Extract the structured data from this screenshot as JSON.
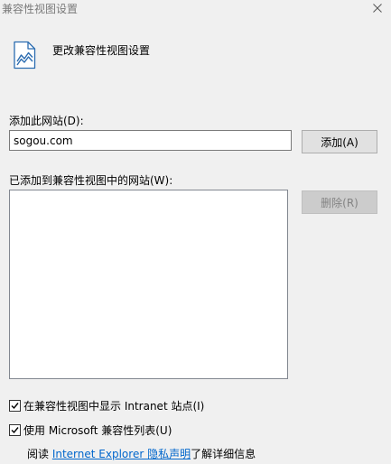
{
  "window": {
    "title": "兼容性视图设置"
  },
  "header": {
    "title": "更改兼容性视图设置",
    "icon": "page-chart-icon"
  },
  "add_site": {
    "label": "添加此网站(D):",
    "value": "sogou.com",
    "button_label": "添加(A)"
  },
  "site_list": {
    "label": "已添加到兼容性视图中的网站(W):",
    "items": [],
    "remove_button_label": "删除(R)"
  },
  "options": {
    "intranet": {
      "label": "在兼容性视图中显示 Intranet 站点(I)",
      "checked": true
    },
    "ms_list": {
      "label": "使用 Microsoft 兼容性列表(U)",
      "checked": true
    }
  },
  "footer": {
    "prefix": "阅读 ",
    "link_label": "Internet Explorer 隐私声明",
    "suffix": "了解详细信息"
  },
  "colors": {
    "link": "#0066cc",
    "background": "#f0f0f0",
    "icon": "#2b6cb0"
  }
}
